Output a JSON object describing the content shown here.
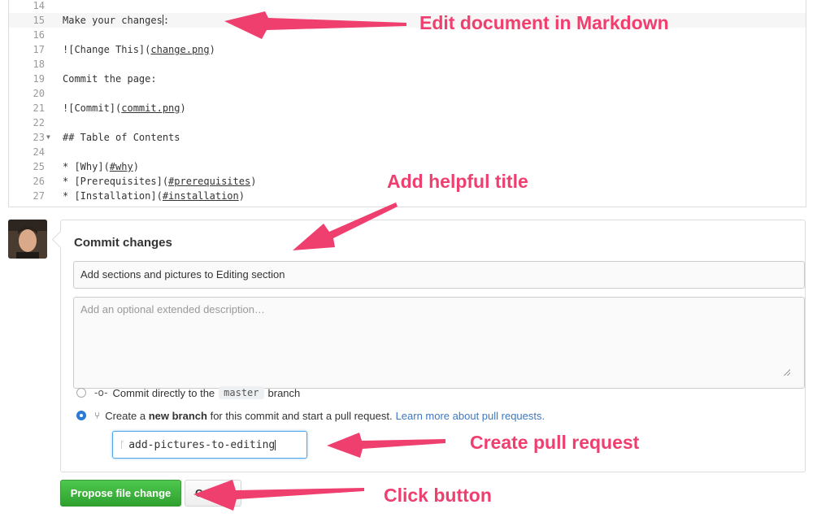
{
  "editor": {
    "lines": [
      {
        "num": "14",
        "segments": [],
        "active": false
      },
      {
        "num": "15",
        "segments": [
          {
            "t": "Make your changes"
          }
        ],
        "active": true,
        "cursor": true
      },
      {
        "num": "16",
        "segments": []
      },
      {
        "num": "17",
        "segments": [
          {
            "t": "![Change This]("
          },
          {
            "t": "change.png",
            "u": true
          },
          {
            "t": ")"
          }
        ]
      },
      {
        "num": "18",
        "segments": []
      },
      {
        "num": "19",
        "segments": [
          {
            "t": "Commit the page:"
          }
        ]
      },
      {
        "num": "20",
        "segments": []
      },
      {
        "num": "21",
        "segments": [
          {
            "t": "![Commit]("
          },
          {
            "t": "commit.png",
            "u": true
          },
          {
            "t": ")"
          }
        ]
      },
      {
        "num": "22",
        "segments": []
      },
      {
        "num": "23",
        "segments": [
          {
            "t": "## Table of Contents"
          }
        ],
        "fold": true
      },
      {
        "num": "24",
        "segments": []
      },
      {
        "num": "25",
        "segments": [
          {
            "t": "* [Why]("
          },
          {
            "t": "#why",
            "u": true
          },
          {
            "t": ")"
          }
        ]
      },
      {
        "num": "26",
        "segments": [
          {
            "t": "* [Prerequisites]("
          },
          {
            "t": "#prerequisites",
            "u": true
          },
          {
            "t": ")"
          }
        ]
      },
      {
        "num": "27",
        "segments": [
          {
            "t": "* [Installation]("
          },
          {
            "t": "#installation",
            "u": true
          },
          {
            "t": ")"
          }
        ]
      }
    ]
  },
  "commit": {
    "title": "Commit changes",
    "summary_value": "Add sections and pictures to Editing section",
    "description_placeholder": "Add an optional extended description…",
    "option_direct": {
      "prefix": "Commit directly to the",
      "branch": "master",
      "suffix": "branch"
    },
    "option_new_branch": {
      "prefix": "Create a",
      "bold": "new branch",
      "suffix": "for this commit and start a pull request.",
      "link": "Learn more about pull requests."
    },
    "branch_name": "add-pictures-to-editing"
  },
  "buttons": {
    "propose_label": "Propose file change",
    "cancel_label": "Cancel"
  },
  "annotations": {
    "edit": "Edit document in Markdown",
    "title": "Add helpful title",
    "pull_request": "Create pull request",
    "click": "Click button"
  },
  "colors": {
    "annotation": "#ef3f6e",
    "accent_green": "#2ea02e",
    "link_blue": "#4078c0"
  }
}
